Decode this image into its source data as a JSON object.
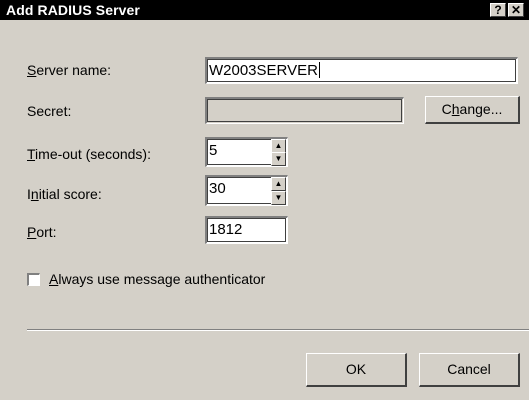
{
  "window": {
    "title": "Add RADIUS Server",
    "help_label": "?",
    "close_label": "✕"
  },
  "form": {
    "server_name": {
      "label_prefix": "",
      "accel": "S",
      "label_rest": "erver name:",
      "value": "W2003SERVER"
    },
    "secret": {
      "label": "Secret:",
      "value": "",
      "change_prefix": "C",
      "change_accel": "h",
      "change_rest": "ange..."
    },
    "timeout": {
      "accel": "T",
      "label_rest": "ime-out (seconds):",
      "value": "5"
    },
    "initial_score": {
      "label_prefix": "I",
      "accel": "n",
      "label_rest": "itial score:",
      "value": "30"
    },
    "port": {
      "accel": "P",
      "label_rest": "ort:",
      "value": "1812"
    },
    "message_auth": {
      "accel": "A",
      "label_rest": "lways use message authenticator",
      "checked": false
    }
  },
  "buttons": {
    "ok": "OK",
    "cancel": "Cancel"
  },
  "spin": {
    "up_glyph": "▲",
    "down_glyph": "▼"
  }
}
